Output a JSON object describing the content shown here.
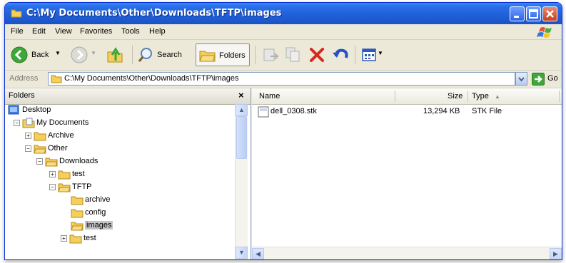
{
  "window": {
    "title": "C:\\My Documents\\Other\\Downloads\\TFTP\\images",
    "controls": {
      "minimize_icon": "minimize-icon",
      "maximize_icon": "maximize-icon",
      "close_icon": "close-icon"
    }
  },
  "menubar": {
    "items": [
      "File",
      "Edit",
      "View",
      "Favorites",
      "Tools",
      "Help"
    ]
  },
  "toolbar": {
    "back_label": "Back",
    "search_label": "Search",
    "folders_label": "Folders"
  },
  "address": {
    "label": "Address",
    "value": "C:\\My Documents\\Other\\Downloads\\TFTP\\images",
    "go_label": "Go"
  },
  "folders_pane": {
    "title": "Folders",
    "close_glyph": "×",
    "tree": [
      {
        "label": "Desktop"
      },
      {
        "label": "My Documents",
        "expander": "−"
      },
      {
        "label": "Archive",
        "expander": "+"
      },
      {
        "label": "Other",
        "expander": "−"
      },
      {
        "label": "Downloads",
        "expander": "−"
      },
      {
        "label": "test",
        "expander": "+"
      },
      {
        "label": "TFTP",
        "expander": "−"
      },
      {
        "label": "archive"
      },
      {
        "label": "config"
      },
      {
        "label": "images",
        "selected": true
      },
      {
        "label": "test",
        "expander": "+"
      }
    ]
  },
  "file_list": {
    "columns": [
      "Name",
      "Size",
      "Type"
    ],
    "sort_indicator": "▲",
    "rows": [
      {
        "name": "dell_0308.stk",
        "size": "13,294 KB",
        "type": "STK File"
      }
    ]
  },
  "colors": {
    "titlebar": "#2a6fe8",
    "folder": "#f4cf5b",
    "close_red": "#c4411f",
    "go_green": "#3fa63a",
    "selection": "#c4c4c4"
  }
}
